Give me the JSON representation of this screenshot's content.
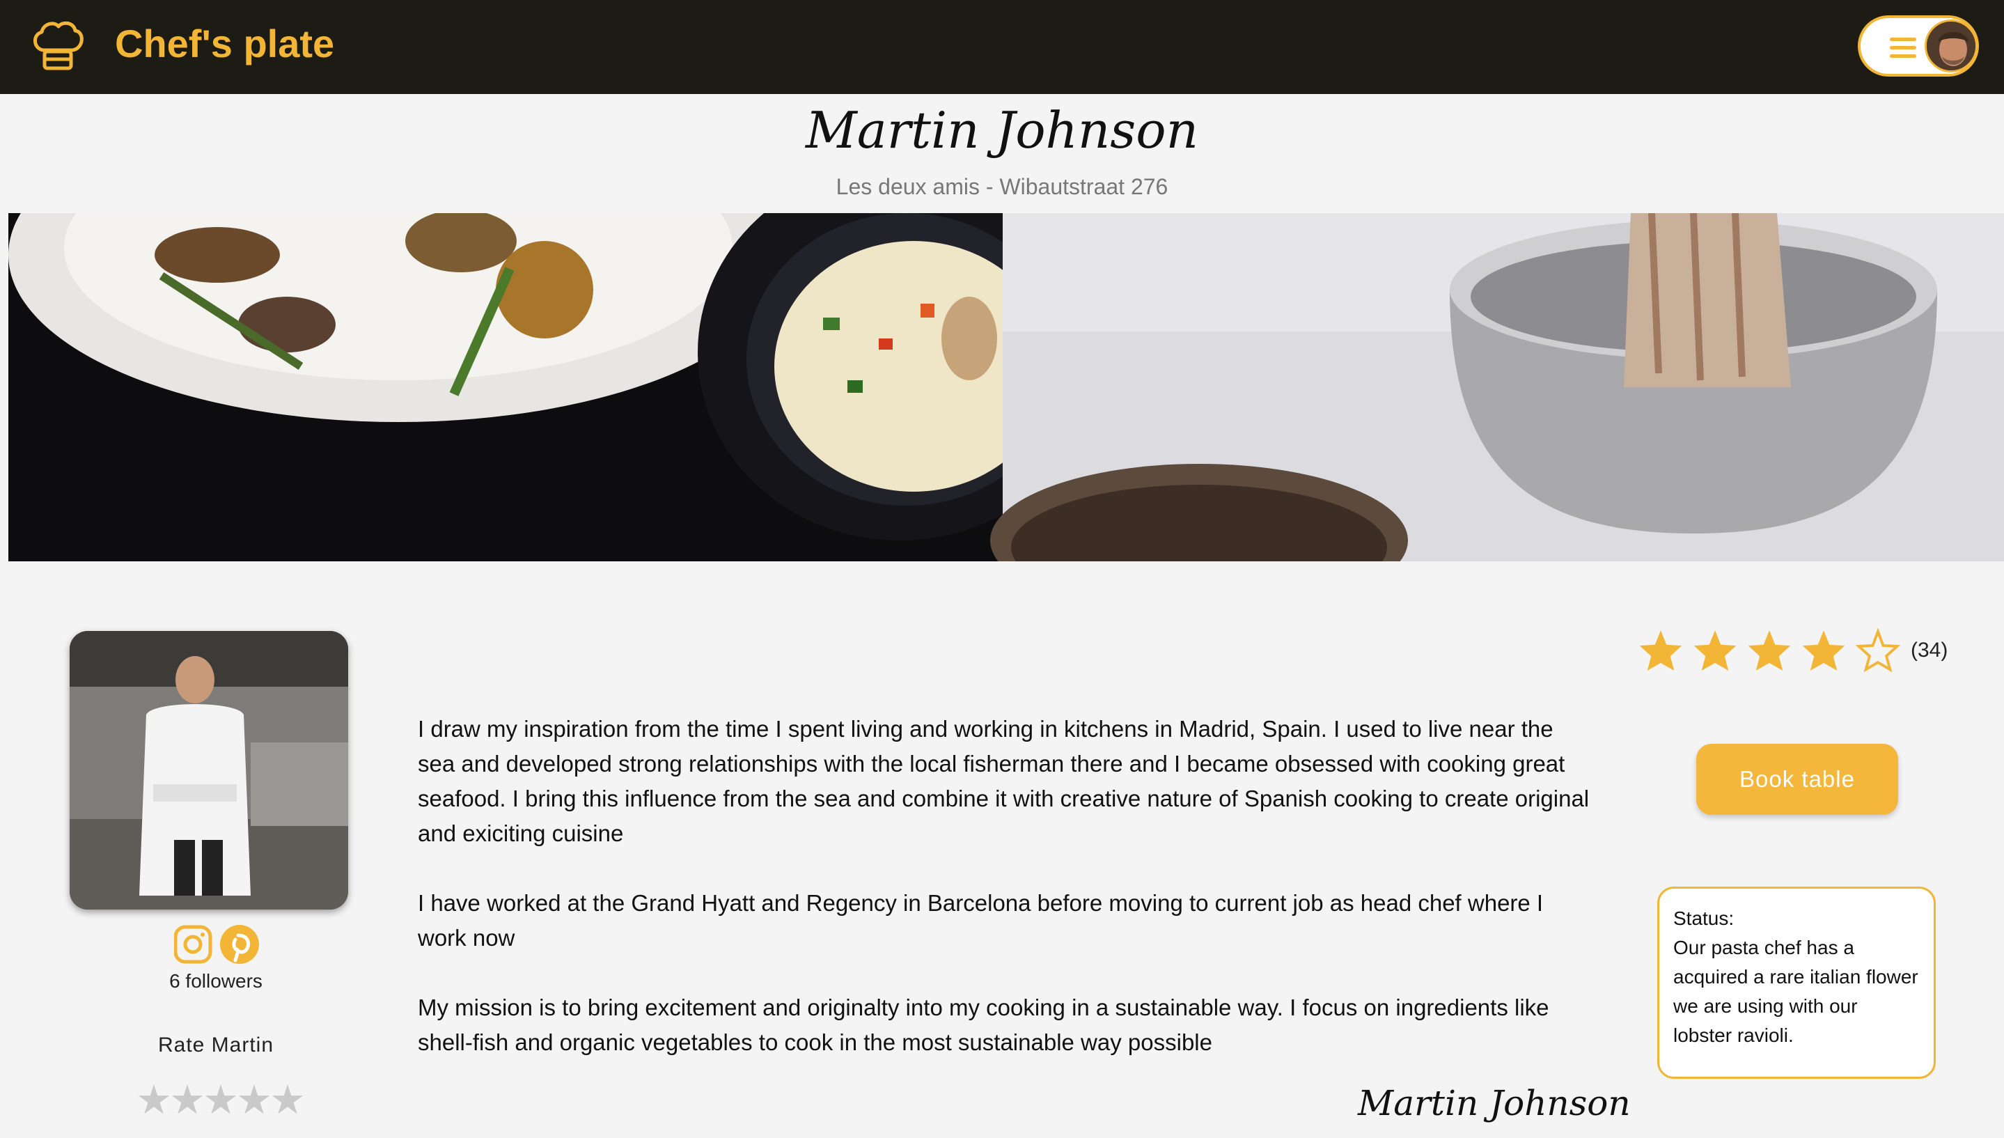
{
  "header": {
    "brand": "Chef's plate",
    "logo_icon": "chef-hat-icon",
    "menu_icon": "hamburger-icon",
    "accent_color": "#f2b535",
    "bar_color": "#1d1c14"
  },
  "chef": {
    "name": "Martin Johnson",
    "restaurant": "Les deux amis - Wibautstraat 276",
    "followers": "6 followers",
    "rate_label": "Rate Martin",
    "signature": "Martin Johnson"
  },
  "rating": {
    "average_stars": 4,
    "max_stars": 5,
    "count_label": "(34)",
    "user_rating": 0
  },
  "bio": {
    "paragraphs": [
      "I draw my inspiration from the time I spent living and working in kitchens in Madrid, Spain. I used to live near the sea and developed strong relationships with the local fisherman there and I became obsessed with cooking great seafood. I bring this influence from the sea and combine it with creative nature of Spanish cooking to create original and exiciting cuisine",
      "I have worked at the Grand Hyatt and Regency in Barcelona before moving to current job as head chef where I work now",
      "My mission is to bring excitement and originalty into my cooking in a sustainable way. I focus on ingredients like shell-fish and organic vegetables to cook in the most sustainable way possible"
    ]
  },
  "actions": {
    "book_label": "Book table"
  },
  "status": {
    "label": "Status:",
    "text": "Our pasta chef has a acquired a rare italian flower we are using with our lobster ravioli."
  },
  "social": {
    "icons": [
      "instagram-icon",
      "pinterest-icon"
    ]
  }
}
